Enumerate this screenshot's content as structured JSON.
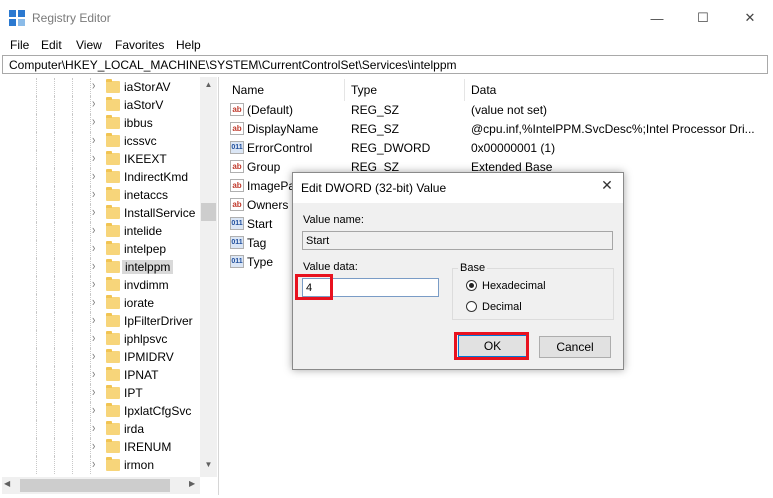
{
  "window": {
    "title": "Registry Editor",
    "min_glyph": "—",
    "max_glyph": "☐",
    "close_glyph": "✕"
  },
  "menu": [
    "File",
    "Edit",
    "View",
    "Favorites",
    "Help"
  ],
  "address": "Computer\\HKEY_LOCAL_MACHINE\\SYSTEM\\CurrentControlSet\\Services\\intelppm",
  "tree": {
    "items": [
      {
        "label": "iaStorAV",
        "selected": false
      },
      {
        "label": "iaStorV",
        "selected": false
      },
      {
        "label": "ibbus",
        "selected": false
      },
      {
        "label": "icssvc",
        "selected": false
      },
      {
        "label": "IKEEXT",
        "selected": false
      },
      {
        "label": "IndirectKmd",
        "selected": false
      },
      {
        "label": "inetaccs",
        "selected": false
      },
      {
        "label": "InstallService",
        "selected": false
      },
      {
        "label": "intelide",
        "selected": false
      },
      {
        "label": "intelpep",
        "selected": false
      },
      {
        "label": "intelppm",
        "selected": true
      },
      {
        "label": "invdimm",
        "selected": false
      },
      {
        "label": "iorate",
        "selected": false
      },
      {
        "label": "IpFilterDriver",
        "selected": false
      },
      {
        "label": "iphlpsvc",
        "selected": false
      },
      {
        "label": "IPMIDRV",
        "selected": false
      },
      {
        "label": "IPNAT",
        "selected": false
      },
      {
        "label": "IPT",
        "selected": false
      },
      {
        "label": "IpxlatCfgSvc",
        "selected": false
      },
      {
        "label": "irda",
        "selected": false
      },
      {
        "label": "IRENUM",
        "selected": false
      },
      {
        "label": "irmon",
        "selected": false
      }
    ]
  },
  "values": {
    "columns": {
      "name": "Name",
      "type": "Type",
      "data": "Data"
    },
    "rows": [
      {
        "name": "(Default)",
        "type": "REG_SZ",
        "data": "(value not set)",
        "icon": "string-value-icon"
      },
      {
        "name": "DisplayName",
        "type": "REG_SZ",
        "data": "@cpu.inf,%IntelPPM.SvcDesc%;Intel Processor Dri...",
        "icon": "string-value-icon"
      },
      {
        "name": "ErrorControl",
        "type": "REG_DWORD",
        "data": "0x00000001 (1)",
        "icon": "dword-value-icon"
      },
      {
        "name": "Group",
        "type": "REG_SZ",
        "data": "Extended Base",
        "icon": "string-value-icon"
      },
      {
        "name": "ImagePa",
        "type": "",
        "data": "ers\\intelppm.sys",
        "icon": "string-value-icon"
      },
      {
        "name": "Owners",
        "type": "",
        "data": "",
        "icon": "string-value-icon"
      },
      {
        "name": "Start",
        "type": "",
        "data": "",
        "icon": "dword-value-icon"
      },
      {
        "name": "Tag",
        "type": "",
        "data": "",
        "icon": "dword-value-icon"
      },
      {
        "name": "Type",
        "type": "",
        "data": "",
        "icon": "dword-value-icon"
      }
    ]
  },
  "dialog": {
    "title": "Edit DWORD (32-bit) Value",
    "close_glyph": "✕",
    "value_name_label": "Value name:",
    "value_name": "Start",
    "value_data_label": "Value data:",
    "value_data": "4",
    "base_label": "Base",
    "hex_label": "Hexadecimal",
    "dec_label": "Decimal",
    "hex_selected": true,
    "ok_label": "OK",
    "cancel_label": "Cancel"
  },
  "colors": {
    "highlight": "#e8121f",
    "folder": "#f7d57a",
    "selected_bg": "#d9d9d9"
  }
}
